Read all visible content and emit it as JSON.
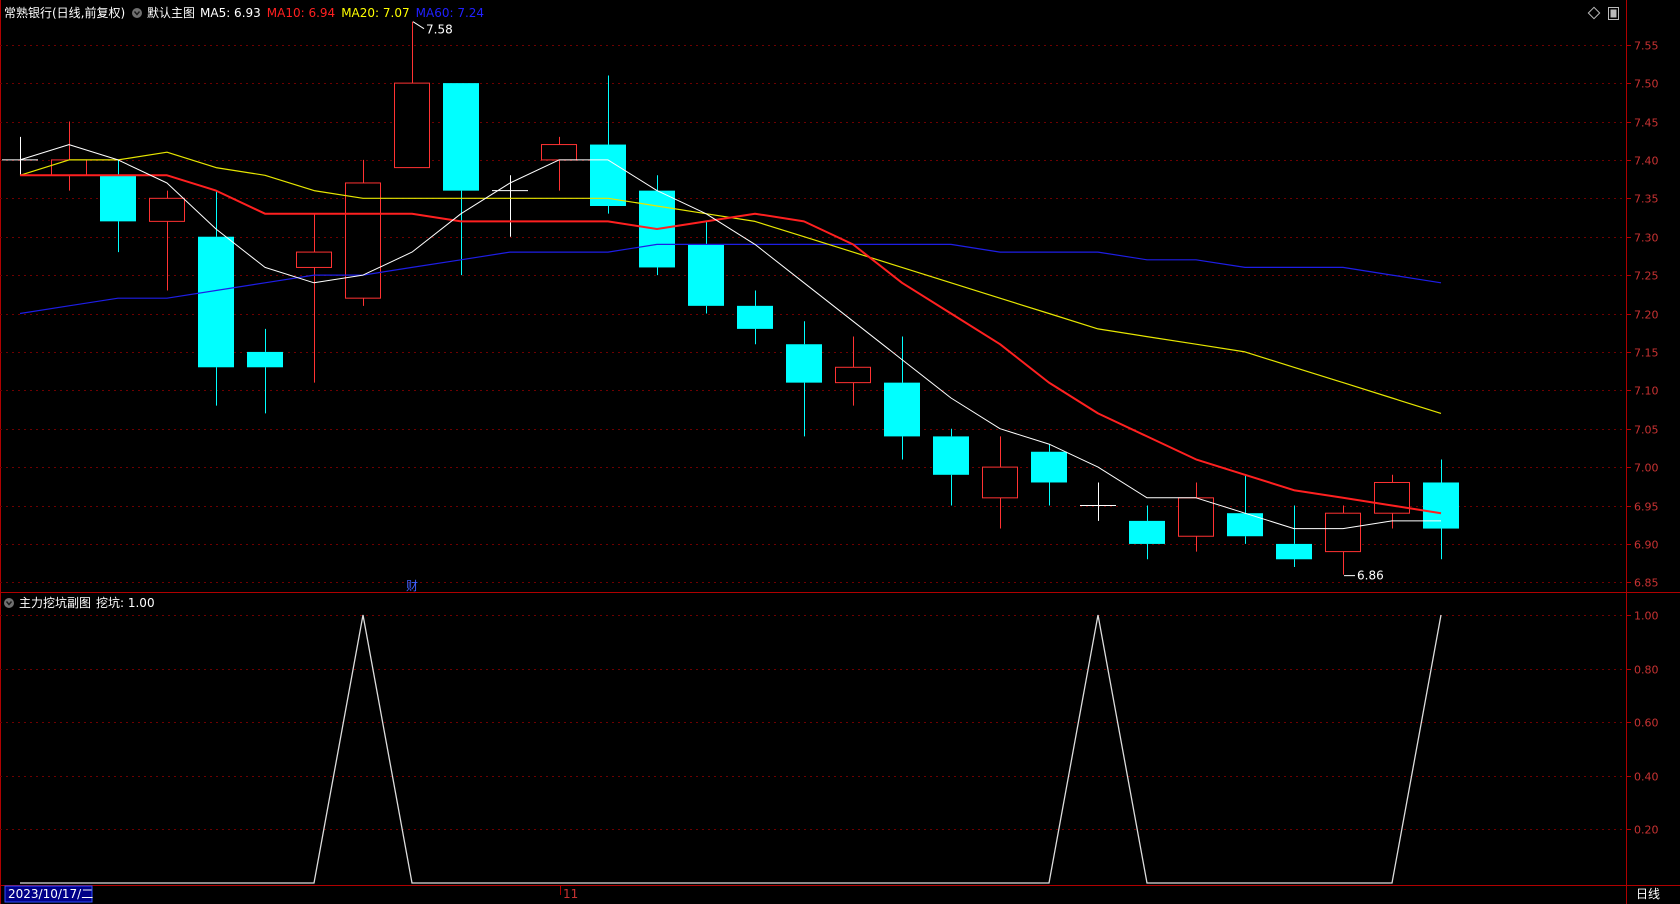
{
  "main_header": {
    "stock_title": "常熟银行(日线,前复权)",
    "view_label": "默认主图",
    "ma_items": [
      {
        "label": "MA5: 6.93",
        "color": "#ffffff"
      },
      {
        "label": "MA10: 6.94",
        "color": "#ff2020"
      },
      {
        "label": "MA20: 7.07",
        "color": "#ffff00"
      },
      {
        "label": "MA60: 7.24",
        "color": "#2020ff"
      }
    ]
  },
  "sub_header": {
    "title": "主力挖坑副图",
    "value_label": "挖坑: 1.00"
  },
  "footer": {
    "date_label": "2023/10/17/二",
    "month_label": "11",
    "period_label": "日线"
  },
  "marker_label": "财",
  "annotations": {
    "high_label": "7.58",
    "low_label": "6.86"
  },
  "colors": {
    "up": "#ff3232",
    "down": "#00ffff",
    "grid": "#6e0000",
    "axis": "#b00000",
    "ma5": "#ffffff",
    "ma10": "#ff2020",
    "ma20": "#e6e600",
    "ma60": "#1e1ee6",
    "sub_line": "#dcdcdc",
    "date_box": "#000088"
  },
  "chart_data": [
    {
      "type": "candlestick",
      "y_ticks": [
        "7.55",
        "7.50",
        "7.45",
        "7.40",
        "7.35",
        "7.30",
        "7.25",
        "7.20",
        "7.15",
        "7.10",
        "7.05",
        "7.00",
        "6.95",
        "6.90",
        "6.85"
      ],
      "ylim": [
        6.84,
        7.59
      ],
      "candles": [
        {
          "o": 7.4,
          "h": 7.43,
          "l": 7.38,
          "c": 7.4
        },
        {
          "o": 7.38,
          "h": 7.45,
          "l": 7.36,
          "c": 7.4
        },
        {
          "o": 7.38,
          "h": 7.4,
          "l": 7.28,
          "c": 7.32
        },
        {
          "o": 7.32,
          "h": 7.36,
          "l": 7.23,
          "c": 7.35
        },
        {
          "o": 7.3,
          "h": 7.36,
          "l": 7.08,
          "c": 7.13
        },
        {
          "o": 7.15,
          "h": 7.18,
          "l": 7.07,
          "c": 7.13
        },
        {
          "o": 7.26,
          "h": 7.33,
          "l": 7.11,
          "c": 7.28
        },
        {
          "o": 7.22,
          "h": 7.4,
          "l": 7.21,
          "c": 7.37
        },
        {
          "o": 7.39,
          "h": 7.58,
          "l": 7.39,
          "c": 7.5
        },
        {
          "o": 7.5,
          "h": 7.5,
          "l": 7.25,
          "c": 7.36
        },
        {
          "o": 7.36,
          "h": 7.38,
          "l": 7.3,
          "c": 7.36
        },
        {
          "o": 7.4,
          "h": 7.43,
          "l": 7.36,
          "c": 7.42
        },
        {
          "o": 7.42,
          "h": 7.51,
          "l": 7.33,
          "c": 7.34
        },
        {
          "o": 7.36,
          "h": 7.38,
          "l": 7.25,
          "c": 7.26
        },
        {
          "o": 7.29,
          "h": 7.32,
          "l": 7.2,
          "c": 7.21
        },
        {
          "o": 7.21,
          "h": 7.23,
          "l": 7.16,
          "c": 7.18
        },
        {
          "o": 7.16,
          "h": 7.19,
          "l": 7.04,
          "c": 7.11
        },
        {
          "o": 7.11,
          "h": 7.17,
          "l": 7.08,
          "c": 7.13
        },
        {
          "o": 7.11,
          "h": 7.17,
          "l": 7.01,
          "c": 7.04
        },
        {
          "o": 7.04,
          "h": 7.05,
          "l": 6.95,
          "c": 6.99
        },
        {
          "o": 6.96,
          "h": 7.04,
          "l": 6.92,
          "c": 7.0
        },
        {
          "o": 7.02,
          "h": 7.03,
          "l": 6.95,
          "c": 6.98
        },
        {
          "o": 6.95,
          "h": 6.98,
          "l": 6.93,
          "c": 6.95
        },
        {
          "o": 6.93,
          "h": 6.95,
          "l": 6.88,
          "c": 6.9
        },
        {
          "o": 6.91,
          "h": 6.98,
          "l": 6.89,
          "c": 6.96
        },
        {
          "o": 6.94,
          "h": 6.99,
          "l": 6.9,
          "c": 6.91
        },
        {
          "o": 6.9,
          "h": 6.95,
          "l": 6.87,
          "c": 6.88
        },
        {
          "o": 6.89,
          "h": 6.95,
          "l": 6.86,
          "c": 6.94
        },
        {
          "o": 6.94,
          "h": 6.99,
          "l": 6.92,
          "c": 6.98
        },
        {
          "o": 6.98,
          "h": 7.01,
          "l": 6.88,
          "c": 6.92
        }
      ],
      "series": [
        {
          "name": "MA5",
          "values": [
            7.4,
            7.42,
            7.4,
            7.37,
            7.31,
            7.26,
            7.24,
            7.25,
            7.28,
            7.33,
            7.37,
            7.4,
            7.4,
            7.36,
            7.33,
            7.29,
            7.24,
            7.19,
            7.14,
            7.09,
            7.05,
            7.03,
            7.0,
            6.96,
            6.96,
            6.94,
            6.92,
            6.92,
            6.93,
            6.93
          ]
        },
        {
          "name": "MA10",
          "values": [
            7.38,
            7.38,
            7.38,
            7.38,
            7.36,
            7.33,
            7.33,
            7.33,
            7.33,
            7.32,
            7.32,
            7.32,
            7.32,
            7.31,
            7.32,
            7.33,
            7.32,
            7.29,
            7.24,
            7.2,
            7.16,
            7.11,
            7.07,
            7.04,
            7.01,
            6.99,
            6.97,
            6.96,
            6.95,
            6.94
          ]
        },
        {
          "name": "MA20",
          "values": [
            7.38,
            7.4,
            7.4,
            7.41,
            7.39,
            7.38,
            7.36,
            7.35,
            7.35,
            7.35,
            7.35,
            7.35,
            7.35,
            7.34,
            7.33,
            7.32,
            7.3,
            7.28,
            7.26,
            7.24,
            7.22,
            7.2,
            7.18,
            7.17,
            7.16,
            7.15,
            7.13,
            7.11,
            7.09,
            7.07
          ]
        },
        {
          "name": "MA60",
          "values": [
            7.2,
            7.21,
            7.22,
            7.22,
            7.23,
            7.24,
            7.25,
            7.25,
            7.26,
            7.27,
            7.28,
            7.28,
            7.28,
            7.29,
            7.29,
            7.29,
            7.29,
            7.29,
            7.29,
            7.29,
            7.28,
            7.28,
            7.28,
            7.27,
            7.27,
            7.26,
            7.26,
            7.26,
            7.25,
            7.24
          ]
        }
      ]
    },
    {
      "type": "line",
      "y_ticks": [
        "1.00",
        "0.80",
        "0.60",
        "0.40",
        "0.20"
      ],
      "ylim": [
        0,
        1.0
      ],
      "series": [
        {
          "name": "挖坑",
          "values": [
            0,
            0,
            0,
            0,
            0,
            0,
            0,
            1,
            0,
            0,
            0,
            0,
            0,
            0,
            0,
            0,
            0,
            0,
            0,
            0,
            0,
            0,
            1,
            0,
            0,
            0,
            0,
            0,
            0,
            1
          ]
        }
      ]
    }
  ]
}
